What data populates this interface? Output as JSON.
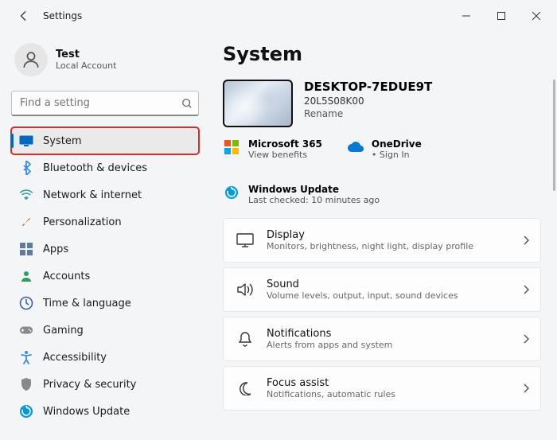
{
  "window": {
    "title": "Settings"
  },
  "profile": {
    "name": "Test",
    "subtitle": "Local Account"
  },
  "search": {
    "placeholder": "Find a setting"
  },
  "nav": [
    {
      "id": "system",
      "label": "System",
      "icon": "monitor",
      "color": "#0067c0",
      "active": true,
      "highlighted": true
    },
    {
      "id": "bluetooth",
      "label": "Bluetooth & devices",
      "icon": "bluetooth",
      "color": "#3a8dde"
    },
    {
      "id": "network",
      "label": "Network & internet",
      "icon": "wifi",
      "color": "#3aa0a0"
    },
    {
      "id": "personalization",
      "label": "Personalization",
      "icon": "brush",
      "color": "#c06a3a"
    },
    {
      "id": "apps",
      "label": "Apps",
      "icon": "apps",
      "color": "#5f7b9c"
    },
    {
      "id": "accounts",
      "label": "Accounts",
      "icon": "person",
      "color": "#2f9f5f"
    },
    {
      "id": "time",
      "label": "Time & language",
      "icon": "clockglobe",
      "color": "#3a5fbf"
    },
    {
      "id": "gaming",
      "label": "Gaming",
      "icon": "gamepad",
      "color": "#8a8a8a"
    },
    {
      "id": "accessibility",
      "label": "Accessibility",
      "icon": "accessibility",
      "color": "#3a8dde"
    },
    {
      "id": "privacy",
      "label": "Privacy & security",
      "icon": "shield",
      "color": "#888"
    },
    {
      "id": "update",
      "label": "Windows Update",
      "icon": "refresh",
      "color": "#0099dd"
    }
  ],
  "main": {
    "heading": "System",
    "device": {
      "name": "DESKTOP-7EDUE9T",
      "model": "20L5S08K00",
      "rename": "Rename"
    },
    "services": [
      {
        "id": "m365",
        "title": "Microsoft 365",
        "sub": "View benefits",
        "icon": "m365"
      },
      {
        "id": "onedrive",
        "title": "OneDrive",
        "sub": "Sign In",
        "icon": "cloud",
        "dot": true
      },
      {
        "id": "winupdate",
        "title": "Windows Update",
        "sub": "Last checked: 10 minutes ago",
        "icon": "refresh"
      }
    ],
    "cards": [
      {
        "id": "display",
        "title": "Display",
        "sub": "Monitors, brightness, night light, display profile",
        "icon": "monitor-outline"
      },
      {
        "id": "sound",
        "title": "Sound",
        "sub": "Volume levels, output, input, sound devices",
        "icon": "sound"
      },
      {
        "id": "notifications",
        "title": "Notifications",
        "sub": "Alerts from apps and system",
        "icon": "bell"
      },
      {
        "id": "focus",
        "title": "Focus assist",
        "sub": "Notifications, automatic rules",
        "icon": "moon"
      }
    ]
  }
}
